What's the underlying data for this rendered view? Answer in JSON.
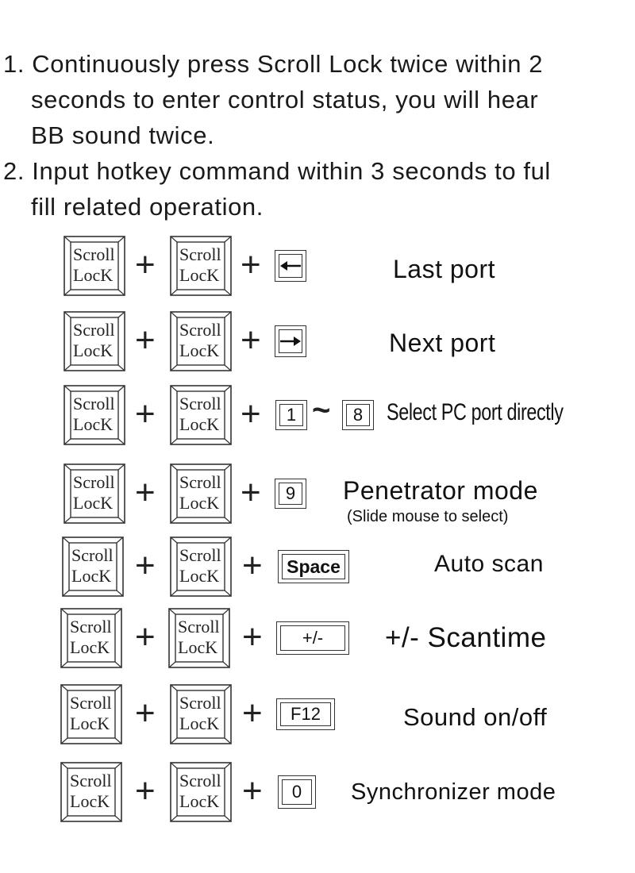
{
  "instructions": [
    {
      "number": "1.",
      "lines": [
        "Continuously press Scroll Lock twice within 2",
        "seconds to enter control status, you will hear",
        "BB sound twice."
      ]
    },
    {
      "number": "2.",
      "lines": [
        "Input hotkey command within 3 seconds to ful",
        "fill related operation."
      ]
    }
  ],
  "scroll_lock_key": {
    "line1": "Scroll",
    "line2": "LocK"
  },
  "plus_symbol": "+",
  "hotkeys": [
    {
      "key": "left-arrow-icon",
      "label": "Last port"
    },
    {
      "key": "right-arrow-icon",
      "label": "Next port"
    },
    {
      "key": "1",
      "key_end": "8",
      "range_symbol": "~",
      "label": "Select PC port directly"
    },
    {
      "key": "9",
      "label": "Penetrator mode",
      "sublabel": "(Slide mouse to select)"
    },
    {
      "key": "Space",
      "label": "Auto scan"
    },
    {
      "key": "+/-",
      "label": "+/- Scantime"
    },
    {
      "key": "F12",
      "label": "Sound on/off"
    },
    {
      "key": "0",
      "label": "Synchronizer mode"
    }
  ]
}
